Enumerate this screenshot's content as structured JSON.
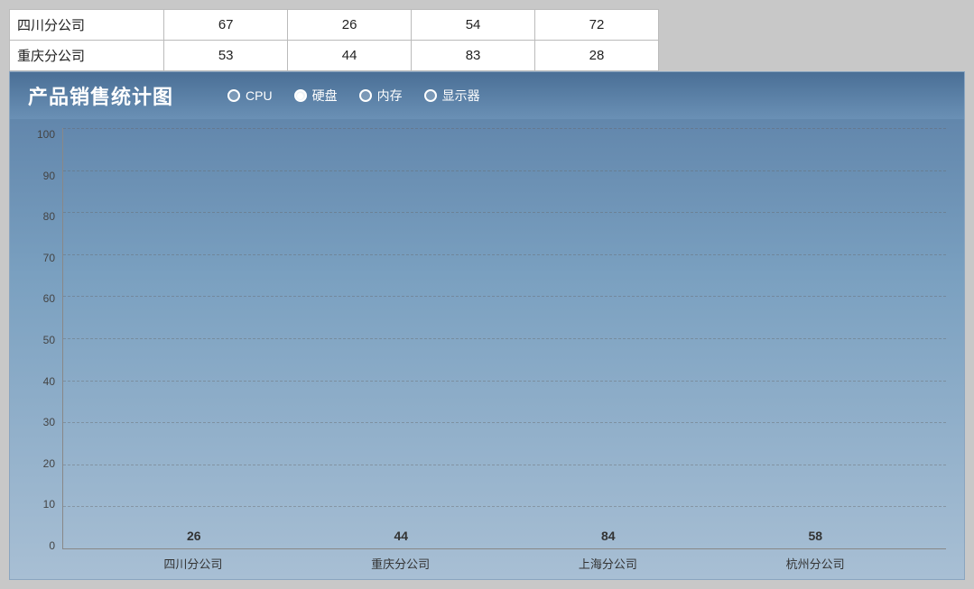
{
  "table": {
    "rows": [
      {
        "name": "四川分公司",
        "col1": "67",
        "col2": "26",
        "col3": "54",
        "col4": "72"
      },
      {
        "name": "重庆分公司",
        "col1": "53",
        "col2": "44",
        "col3": "83",
        "col4": "28"
      }
    ]
  },
  "chart": {
    "title": "产品销售统计图",
    "legend": [
      {
        "id": "cpu",
        "label": "CPU",
        "selected": false
      },
      {
        "id": "harddisk",
        "label": "硬盘",
        "selected": true
      },
      {
        "id": "memory",
        "label": "内存",
        "selected": false
      },
      {
        "id": "monitor",
        "label": "显示器",
        "selected": false
      }
    ],
    "yAxis": {
      "labels": [
        "100",
        "90",
        "80",
        "70",
        "60",
        "50",
        "40",
        "30",
        "20",
        "10",
        "0"
      ]
    },
    "bars": [
      {
        "label": "四川分公司",
        "value": 26,
        "color": "#4472C4"
      },
      {
        "label": "重庆分公司",
        "value": 44,
        "color": "#ED7D31"
      },
      {
        "label": "上海分公司",
        "value": 84,
        "color": "#A5A5A5"
      },
      {
        "label": "杭州分公司",
        "value": 58,
        "color": "#FFC000"
      }
    ],
    "maxValue": 100
  }
}
